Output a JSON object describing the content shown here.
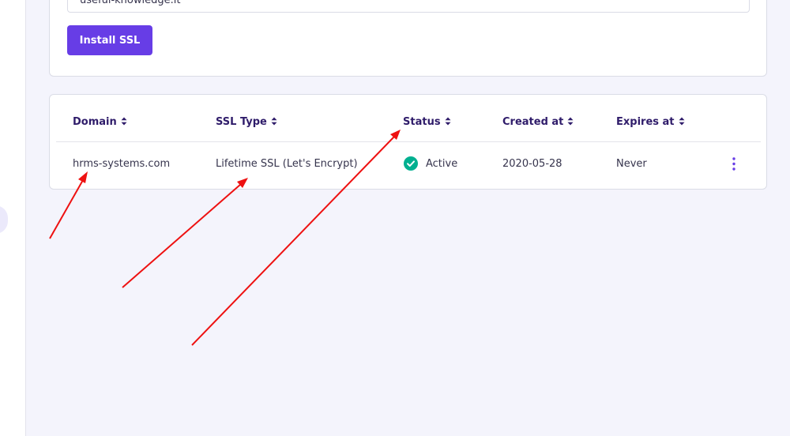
{
  "top_card": {
    "email_value": "useful-knowledge.it",
    "install_button_label": "Install SSL"
  },
  "table": {
    "columns": [
      {
        "label": "Domain"
      },
      {
        "label": "SSL Type"
      },
      {
        "label": "Status"
      },
      {
        "label": "Created at"
      },
      {
        "label": "Expires at"
      }
    ],
    "rows": [
      {
        "domain": "hrms-systems.com",
        "ssl_type": "Lifetime SSL (Let's Encrypt)",
        "status": "Active",
        "created_at": "2020-05-28",
        "expires_at": "Never"
      }
    ]
  },
  "icons": {
    "sort": "sort-arrows-icon",
    "status": "check-circle-icon",
    "menu": "kebab-menu-icon"
  },
  "colors": {
    "accent": "#673de6",
    "status_active": "#00b090",
    "annotation_arrow": "#ee1111",
    "heading_text": "#2f1c6a",
    "background": "#f4f4fc"
  }
}
